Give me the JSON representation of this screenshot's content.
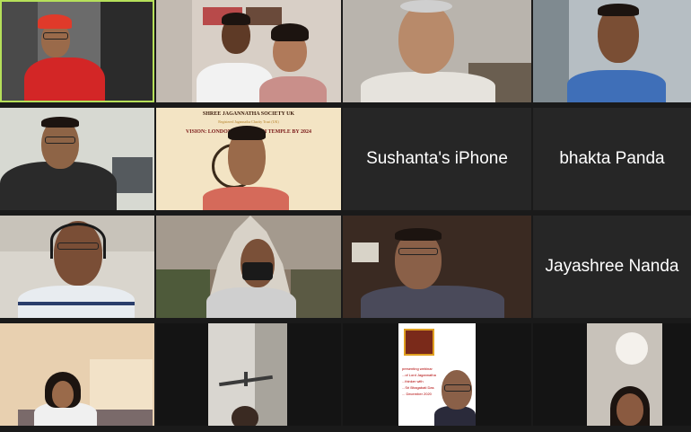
{
  "participants": [
    {
      "name": "",
      "video": true
    },
    {
      "name": "",
      "video": true
    },
    {
      "name": "",
      "video": true
    },
    {
      "name": "",
      "video": true
    },
    {
      "name": "",
      "video": true
    },
    {
      "name": "",
      "video": true
    },
    {
      "name": "Sushanta's iPhone",
      "video": false
    },
    {
      "name": "bhakta Panda",
      "video": false
    },
    {
      "name": "",
      "video": true
    },
    {
      "name": "",
      "video": true
    },
    {
      "name": "",
      "video": true
    },
    {
      "name": "Jayashree Nanda",
      "video": false
    },
    {
      "name": "",
      "video": true
    },
    {
      "name": "",
      "video": true
    },
    {
      "name": "",
      "video": true
    },
    {
      "name": "",
      "video": true
    }
  ],
  "banner": {
    "title": "SHREE JAGANNATHA SOCIETY UK",
    "subtitle": "Registered Jagannatha Charity Trust (UK)",
    "vision": "VISION: LONDON JAGANNATH TEMPLE BY 2024"
  },
  "poster": {
    "lines": [
      "presenting webinar",
      "...of Lord Jagannatha",
      "...thinker with",
      "...Sri Bhagabati Das",
      "... December 2020"
    ]
  },
  "colors": {
    "active_speaker_border": "#b6e05a",
    "tile_bg": "#262626",
    "gallery_bg": "#1a1a1a"
  }
}
